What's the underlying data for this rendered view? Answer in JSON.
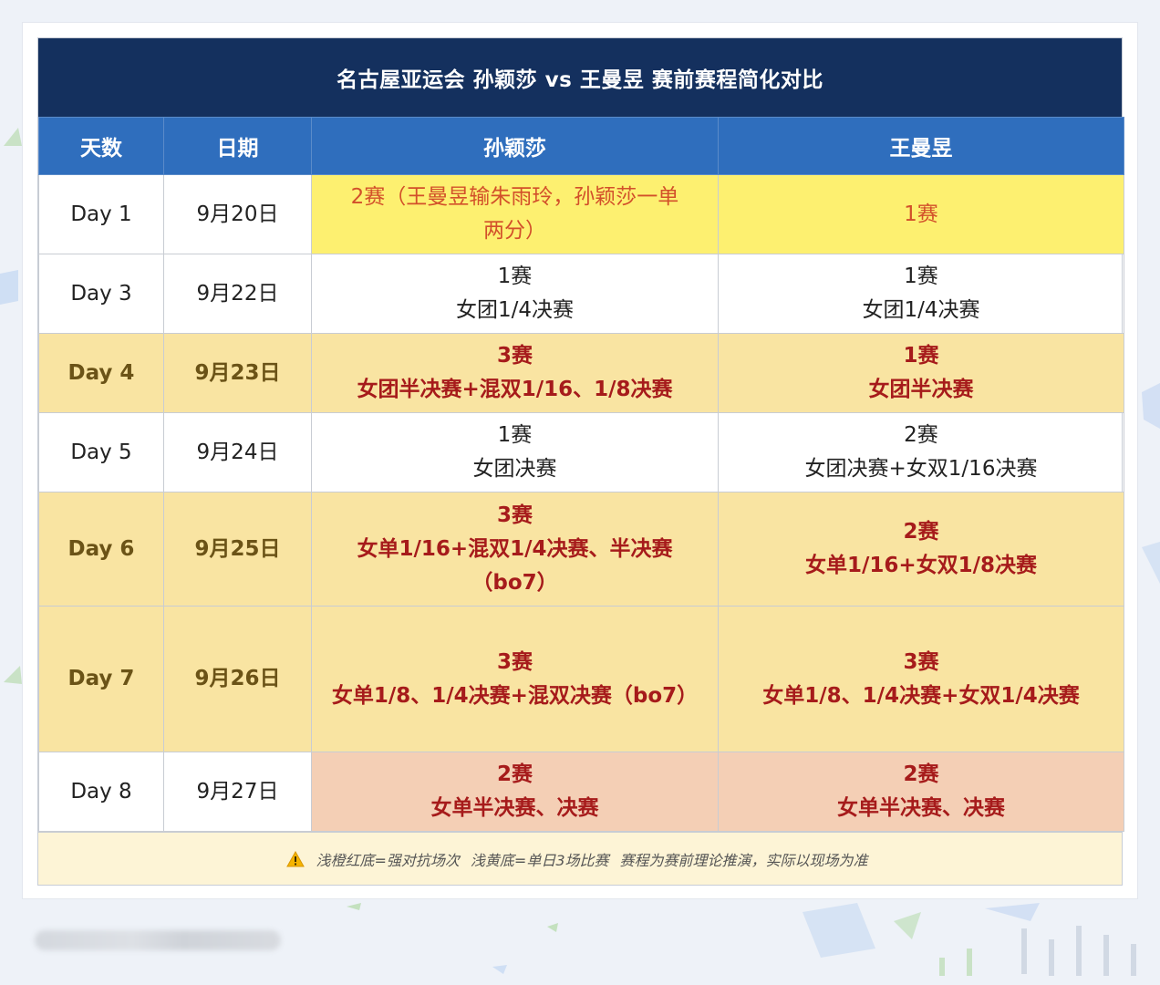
{
  "title": "名古屋亚运会 孙颖莎 vs 王曼昱 赛前赛程简化对比",
  "headers": {
    "day": "天数",
    "date": "日期",
    "sun": "孙颖莎",
    "wang": "王曼昱"
  },
  "rows": [
    {
      "day": "Day 1",
      "date": "9月20日",
      "sun": [
        "2赛（王曼昱输朱雨玲，孙颖莎一单",
        "两分）"
      ],
      "wang": [
        "1赛"
      ]
    },
    {
      "day": "Day 3",
      "date": "9月22日",
      "sun": [
        "1赛",
        "女团1/4决赛"
      ],
      "wang": [
        "1赛",
        "女团1/4决赛"
      ]
    },
    {
      "day": "Day 4",
      "date": "9月23日",
      "sun": [
        "3赛",
        "女团半决赛+混双1/16、1/8决赛"
      ],
      "wang": [
        "1赛",
        "女团半决赛"
      ]
    },
    {
      "day": "Day 5",
      "date": "9月24日",
      "sun": [
        "1赛",
        "女团决赛"
      ],
      "wang": [
        "2赛",
        "女团决赛+女双1/16决赛"
      ]
    },
    {
      "day": "Day 6",
      "date": "9月25日",
      "sun": [
        "3赛",
        "女单1/16+混双1/4决赛、半决赛",
        "（bo7）"
      ],
      "wang": [
        "2赛",
        "女单1/16+女双1/8决赛"
      ]
    },
    {
      "day": "Day 7",
      "date": "9月26日",
      "sun": [
        "3赛",
        "女单1/8、1/4决赛+混双决赛（bo7）"
      ],
      "wang": [
        "3赛",
        "女单1/8、1/4决赛+女双1/4决赛"
      ]
    },
    {
      "day": "Day 8",
      "date": "9月27日",
      "sun": [
        "2赛",
        "女单半决赛、决赛"
      ],
      "wang": [
        "2赛",
        "女单半决赛、决赛"
      ]
    }
  ],
  "footer": {
    "icon": "warning-icon",
    "note1": "浅橙红底=强对抗场次",
    "note2": "浅黄底=单日3场比赛",
    "note3": "赛程为赛前理论推演，实际以现场为准"
  },
  "colors": {
    "title_bg": "#14305e",
    "header_bg": "#2f6ebd",
    "yellow": "#fdf070",
    "tan": "#f9e4a2",
    "peach": "#f4cfb5",
    "accent_red": "#a61b1b"
  }
}
